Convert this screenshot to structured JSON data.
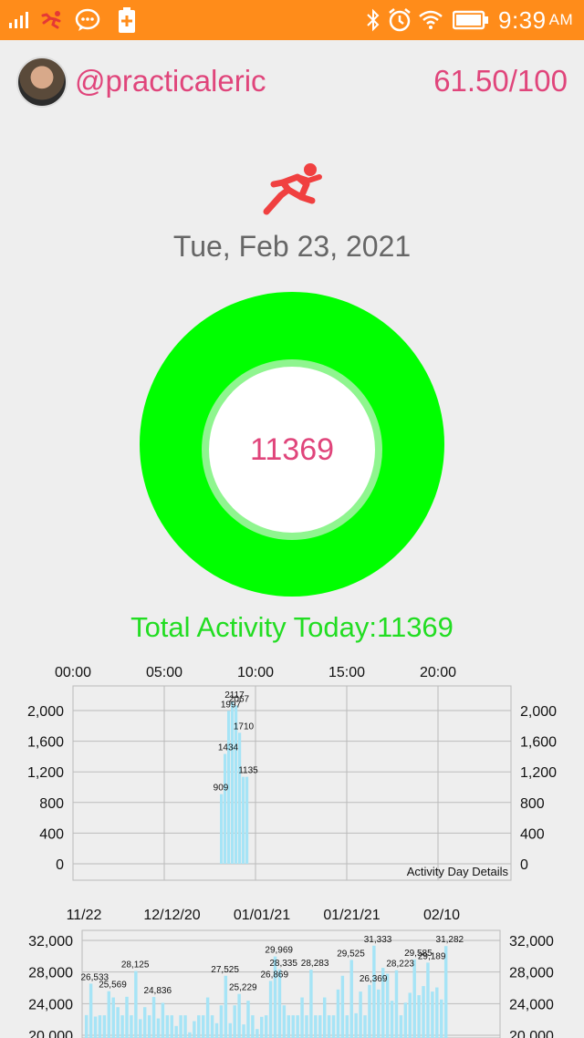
{
  "status_bar": {
    "time": "9:39",
    "ampm": "AM"
  },
  "header": {
    "username": "@practicaleric",
    "score": "61.50/100"
  },
  "date": "Tue, Feb 23, 2021",
  "ring": {
    "value": "11369"
  },
  "total_activity": "Total Activity Today:11369",
  "colors": {
    "accent": "#e0457b",
    "ring": "#00ff00",
    "statusbar": "#ff8c1a",
    "bar": "#a6e4f6",
    "total": "#22dd22"
  },
  "chart_data": [
    {
      "type": "bar",
      "title": "",
      "legend": "Activity Day Details",
      "x_ticks": [
        "00:00",
        "05:00",
        "10:00",
        "15:00",
        "20:00"
      ],
      "x_tick_hours": [
        0,
        5,
        10,
        15,
        20
      ],
      "xlim_hours": [
        0,
        24
      ],
      "y_ticks": [
        "2,000",
        "1,600",
        "1,200",
        "800",
        "400",
        "0"
      ],
      "y_tick_values": [
        2000,
        1600,
        1200,
        800,
        400,
        0
      ],
      "ylim": [
        0,
        2400
      ],
      "series": [
        {
          "hours": [
            8.0,
            8.2,
            8.4,
            8.6,
            8.8,
            9.0,
            9.2,
            9.4
          ],
          "values": [
            909,
            1434,
            1997,
            2117,
            2067,
            1710,
            1135,
            1135
          ]
        }
      ],
      "data_labels": [
        {
          "hour": 8.0,
          "value": 909,
          "text": "909"
        },
        {
          "hour": 8.4,
          "value": 1434,
          "text": "1434"
        },
        {
          "hour": 8.55,
          "value": 1997,
          "text": "1997"
        },
        {
          "hour": 8.75,
          "value": 2117,
          "text": "2117"
        },
        {
          "hour": 9.0,
          "value": 2067,
          "text": "2067"
        },
        {
          "hour": 9.25,
          "value": 1710,
          "text": "1710"
        },
        {
          "hour": 9.5,
          "value": 1135,
          "text": "1135"
        }
      ]
    },
    {
      "type": "bar",
      "title": "",
      "x_ticks": [
        "11/22",
        "12/12/20",
        "01/01/21",
        "01/21/21",
        "02/10"
      ],
      "x_tick_days": [
        0,
        20,
        40,
        60,
        80
      ],
      "xlim_days": [
        0,
        93
      ],
      "y_ticks": [
        "32,000",
        "28,000",
        "24,000",
        "20,000"
      ],
      "y_tick_values": [
        32000,
        28000,
        24000,
        20000
      ],
      "ylim": [
        20000,
        33000
      ],
      "values": [
        22553,
        26533,
        22369,
        22525,
        22525,
        25569,
        24783,
        23553,
        22525,
        24869,
        22525,
        28125,
        22033,
        23553,
        22525,
        24836,
        22125,
        24099,
        22525,
        22525,
        21176,
        22525,
        22525,
        20369,
        21786,
        22525,
        22525,
        24786,
        22525,
        21525,
        23786,
        27525,
        21525,
        23786,
        25229,
        21371,
        24369,
        22525,
        20786,
        22333,
        22525,
        26869,
        29969,
        28335,
        23786,
        22525,
        22525,
        22525,
        24786,
        22525,
        28283,
        22525,
        22525,
        24786,
        22525,
        22525,
        25786,
        27525,
        22525,
        29525,
        22786,
        25525,
        22525,
        26369,
        31333,
        25786,
        28525,
        27786,
        24369,
        28223,
        22525,
        24125,
        25369,
        29585,
        25069,
        26223,
        29189,
        25525,
        26050,
        24525,
        31282
      ],
      "data_labels": [
        {
          "day": 2,
          "text": "26,533",
          "value": 26533
        },
        {
          "day": 11,
          "text": "28,125",
          "value": 28125
        },
        {
          "day": 31,
          "text": "27,525",
          "value": 27525
        },
        {
          "day": 43,
          "text": "29,969",
          "value": 29969
        },
        {
          "day": 44,
          "text": "28,335",
          "value": 28335
        },
        {
          "day": 51,
          "text": "28,283",
          "value": 28283
        },
        {
          "day": 59,
          "text": "29,525",
          "value": 29525
        },
        {
          "day": 65,
          "text": "31,333",
          "value": 31333
        },
        {
          "day": 70,
          "text": "28,223",
          "value": 28223
        },
        {
          "day": 74,
          "text": "29,585",
          "value": 29585
        },
        {
          "day": 77,
          "text": "29,189",
          "value": 29189
        },
        {
          "day": 81,
          "text": "31,282",
          "value": 31282
        },
        {
          "day": 6,
          "text": "25,569",
          "value": 25569
        },
        {
          "day": 16,
          "text": "24,836",
          "value": 24836
        },
        {
          "day": 35,
          "text": "25,229",
          "value": 25229
        },
        {
          "day": 42,
          "text": "26,869",
          "value": 26869
        },
        {
          "day": 64,
          "text": "26,369",
          "value": 26369
        }
      ]
    }
  ]
}
